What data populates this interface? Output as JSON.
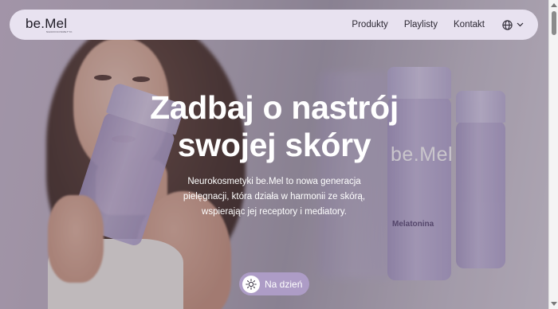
{
  "nav": {
    "logo": "be.Mel",
    "logo_sub": "NEUROCOSMETYK",
    "links": [
      "Produkty",
      "Playlisty",
      "Kontakt"
    ],
    "language_icon": "globe-icon",
    "dropdown_icon": "chevron-down-icon"
  },
  "hero": {
    "headline_line1": "Zadbaj o nastrój",
    "headline_line2": "swojej skóry",
    "description_line1": "Neurokosmetyki be.Mel to nowa generacja",
    "description_line2": "pielęgnacji, która działa w harmonii ze skórą,",
    "description_line3": "wspierając jej receptory i mediatory.",
    "bottle_brand": "be.Mel",
    "bottle_label": "Melatonina"
  },
  "cta": {
    "label": "Na dzień",
    "icon": "sun-icon",
    "color": "#ad9cc6"
  },
  "colors": {
    "nav_bg": "#e8e2f0",
    "accent": "#ad9cc6",
    "text_light": "#ffffff"
  }
}
